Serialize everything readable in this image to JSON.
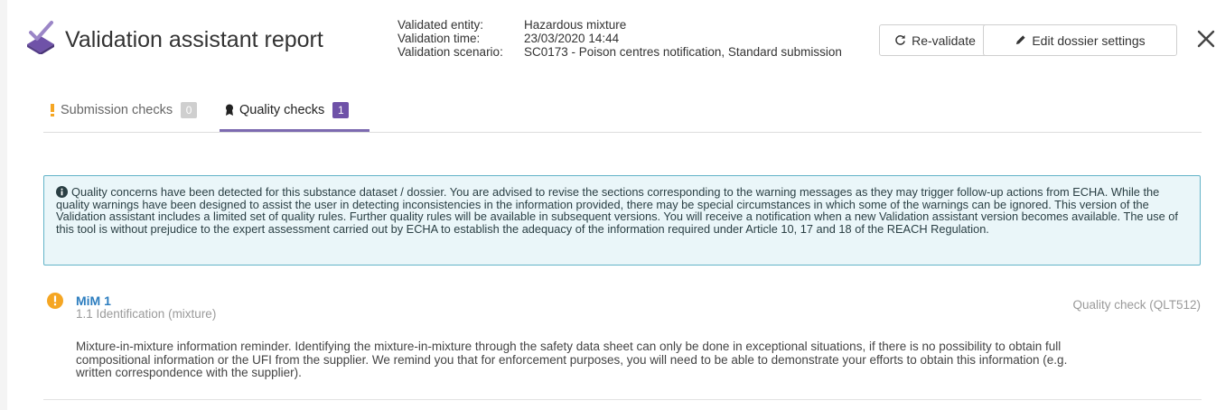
{
  "header": {
    "title": "Validation assistant report",
    "meta": {
      "entity_label": "Validated entity:",
      "entity_value": "Hazardous mixture",
      "time_label": "Validation time:",
      "time_value": "23/03/2020 14:44",
      "scenario_label": "Validation scenario:",
      "scenario_value": "SC0173 - Poison centres notification, Standard submission"
    },
    "revalidate_label": "Re-validate",
    "edit_label": "Edit dossier settings"
  },
  "tabs": [
    {
      "label": "Submission checks",
      "count": "0"
    },
    {
      "label": "Quality checks",
      "count": "1"
    }
  ],
  "info": {
    "text": "Quality concerns have been detected for this substance dataset / dossier. You are advised to revise the sections corresponding to the warning messages as they may trigger follow-up actions from ECHA. While the quality warnings have been designed to assist the user in detecting inconsistencies in the information provided, there may be special circumstances in which some of the warnings can be ignored. This version of the Validation assistant includes a limited set of quality rules. Further quality rules will be available in subsequent versions. You will receive a notification when a new Validation assistant version becomes available. The use of this tool is without prejudice to the expert assessment carried out by ECHA to establish the adequacy of the information required under Article 10, 17 and 18 of the REACH Regulation."
  },
  "result": {
    "title": "MiM 1",
    "section": "1.1 Identification (mixture)",
    "check": "Quality check (QLT512)",
    "text": "Mixture-in-mixture information reminder. Identifying the mixture-in-mixture through the safety data sheet can only be done in exceptional situations, if there is no possibility to obtain full compositional information or the UFI from the supplier. We remind you that for enforcement purposes, you will need to be able to demonstrate your efforts to obtain this information (e.g. written correspondence with the supplier)."
  },
  "colors": {
    "accent": "#6f52a8",
    "link": "#2c7dbf",
    "warning": "#f5a623",
    "info_border": "#62b3c8",
    "info_bg": "#eaf6f9"
  }
}
